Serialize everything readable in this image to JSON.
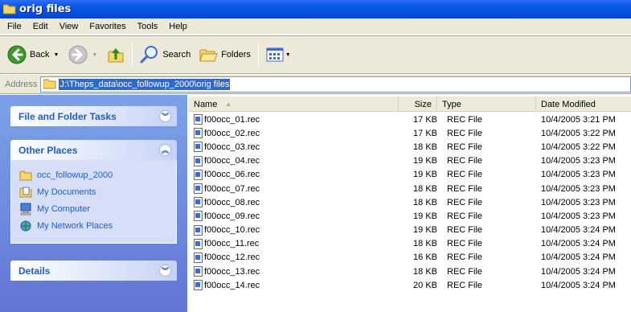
{
  "window": {
    "title": "orig files"
  },
  "menu": [
    "File",
    "Edit",
    "View",
    "Favorites",
    "Tools",
    "Help"
  ],
  "toolbar": {
    "back_label": "Back",
    "search_label": "Search",
    "folders_label": "Folders"
  },
  "address": {
    "label": "Address",
    "value": "J:\\Theps_data\\occ_followup_2000\\orig files"
  },
  "tasks": {
    "file_folder_tasks": "File and Folder Tasks",
    "other_places": "Other Places",
    "places": [
      "occ_followup_2000",
      "My Documents",
      "My Computer",
      "My Network Places"
    ],
    "details": "Details"
  },
  "columns": {
    "name": "Name",
    "size": "Size",
    "type": "Type",
    "date": "Date Modified"
  },
  "files": [
    {
      "name": "f00occ_01.rec",
      "size": "17 KB",
      "type": "REC File",
      "date": "10/4/2005 3:21 PM"
    },
    {
      "name": "f00occ_02.rec",
      "size": "17 KB",
      "type": "REC File",
      "date": "10/4/2005 3:22 PM"
    },
    {
      "name": "f00occ_03.rec",
      "size": "18 KB",
      "type": "REC File",
      "date": "10/4/2005 3:22 PM"
    },
    {
      "name": "f00occ_04.rec",
      "size": "19 KB",
      "type": "REC File",
      "date": "10/4/2005 3:23 PM"
    },
    {
      "name": "f00occ_06.rec",
      "size": "19 KB",
      "type": "REC File",
      "date": "10/4/2005 3:23 PM"
    },
    {
      "name": "f00occ_07.rec",
      "size": "18 KB",
      "type": "REC File",
      "date": "10/4/2005 3:23 PM"
    },
    {
      "name": "f00occ_08.rec",
      "size": "18 KB",
      "type": "REC File",
      "date": "10/4/2005 3:23 PM"
    },
    {
      "name": "f00occ_09.rec",
      "size": "19 KB",
      "type": "REC File",
      "date": "10/4/2005 3:23 PM"
    },
    {
      "name": "f00occ_10.rec",
      "size": "19 KB",
      "type": "REC File",
      "date": "10/4/2005 3:24 PM"
    },
    {
      "name": "f00occ_11.rec",
      "size": "18 KB",
      "type": "REC File",
      "date": "10/4/2005 3:24 PM"
    },
    {
      "name": "f00occ_12.rec",
      "size": "16 KB",
      "type": "REC File",
      "date": "10/4/2005 3:24 PM"
    },
    {
      "name": "f00occ_13.rec",
      "size": "18 KB",
      "type": "REC File",
      "date": "10/4/2005 3:24 PM"
    },
    {
      "name": "f00occ_14.rec",
      "size": "20 KB",
      "type": "REC File",
      "date": "10/4/2005 3:24 PM"
    }
  ]
}
